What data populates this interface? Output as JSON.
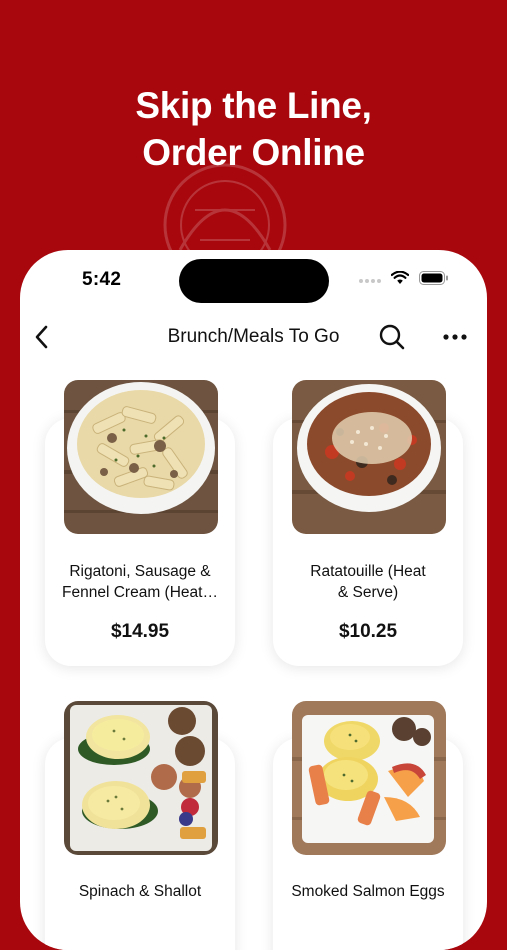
{
  "promo": {
    "headline_line1": "Skip the Line,",
    "headline_line2": "Order Online"
  },
  "status_bar": {
    "time": "5:42",
    "icons": [
      "signal-icon",
      "wifi-icon",
      "battery-icon"
    ]
  },
  "nav": {
    "title": "Brunch/Meals To Go",
    "back_icon": "chevron-left-icon",
    "search_icon": "search-icon",
    "more_icon": "more-icon"
  },
  "items": [
    {
      "name_line1": "Rigatoni, Sausage &",
      "name_line2": "Fennel Cream (Heat…",
      "price": "$14.95"
    },
    {
      "name_line1": "Ratatouille (Heat",
      "name_line2": "& Serve)",
      "price": "$10.25"
    },
    {
      "name_line1": "Spinach & Shallot",
      "name_line2": "",
      "price": ""
    },
    {
      "name_line1": "Smoked Salmon Eggs",
      "name_line2": "",
      "price": ""
    }
  ],
  "colors": {
    "brand_red": "#a8070d",
    "text": "#111111",
    "card_bg": "#ffffff"
  }
}
